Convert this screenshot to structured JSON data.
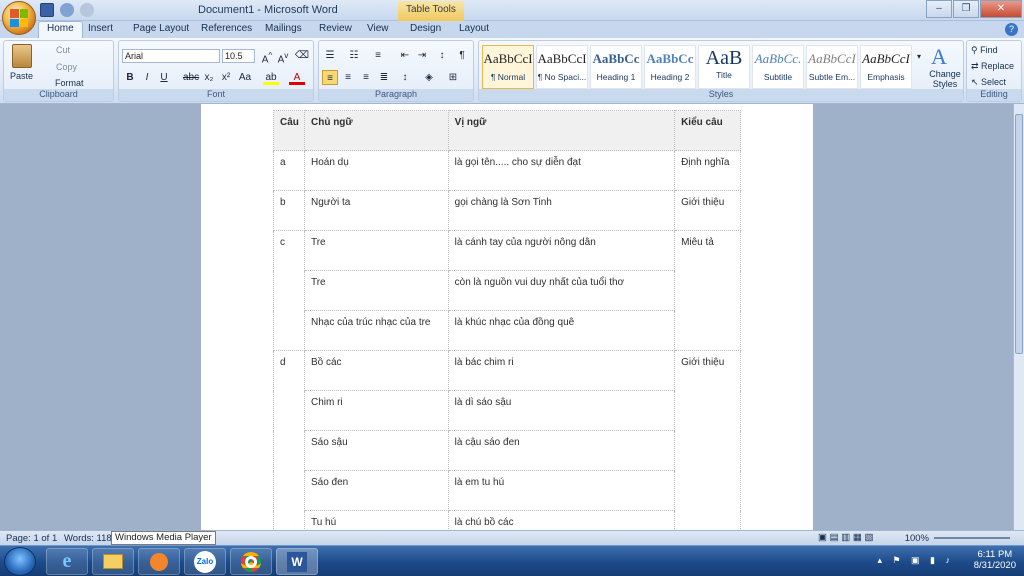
{
  "window": {
    "title": "Document1 - Microsoft Word",
    "contextual_tab": "Table Tools"
  },
  "tabs": [
    "Home",
    "Insert",
    "Page Layout",
    "References",
    "Mailings",
    "Review",
    "View",
    "Design",
    "Layout"
  ],
  "ribbon": {
    "clipboard": {
      "paste": "Paste",
      "cut": "Cut",
      "copy": "Copy",
      "format_painter": "Format Painter",
      "label": "Clipboard"
    },
    "font": {
      "name": "Arial",
      "size": "10.5",
      "label": "Font"
    },
    "paragraph": {
      "label": "Paragraph"
    },
    "styles": {
      "items": [
        {
          "sample": "AaBbCcI",
          "name": "¶ Normal"
        },
        {
          "sample": "AaBbCcI",
          "name": "¶ No Spaci..."
        },
        {
          "sample": "AaBbCc",
          "name": "Heading 1"
        },
        {
          "sample": "AaBbCc",
          "name": "Heading 2"
        },
        {
          "sample": "AaB",
          "name": "Title"
        },
        {
          "sample": "AaBbCc.",
          "name": "Subtitle"
        },
        {
          "sample": "AaBbCcI",
          "name": "Subtle Em..."
        },
        {
          "sample": "AaBbCcI",
          "name": "Emphasis"
        }
      ],
      "change_styles": "Change Styles",
      "label": "Styles"
    },
    "editing": {
      "find": "Find",
      "replace": "Replace",
      "select": "Select",
      "label": "Editing"
    }
  },
  "table": {
    "headers": [
      "Câu",
      "Chủ ngữ",
      "Vị ngữ",
      "Kiểu câu"
    ],
    "rows": [
      [
        "a",
        "Hoán dụ",
        "là gọi tên..... cho sự diễn đạt",
        "Định nghĩa"
      ],
      [
        "b",
        "Người ta",
        "gọi chàng là Sơn Tinh",
        "Giới thiệu"
      ],
      [
        "c",
        "Tre",
        "là cánh tay của người nông dân",
        "Miêu tả"
      ],
      [
        "",
        "Tre",
        "còn là nguồn vui duy nhất của tuổi thơ",
        ""
      ],
      [
        "",
        "Nhạc của trúc nhạc của tre",
        "là khúc nhạc của đồng quê",
        ""
      ],
      [
        "d",
        "Bồ các",
        "là bác chim ri",
        "Giới thiệu"
      ],
      [
        "",
        "Chim ri",
        "là dì sáo sậu",
        ""
      ],
      [
        "",
        "Sáo sậu",
        "là cậu sáo đen",
        ""
      ],
      [
        "",
        "Sáo đen",
        "là em tu hú",
        ""
      ],
      [
        "",
        "Tu hú",
        "là chú bồ các",
        ""
      ]
    ]
  },
  "status": {
    "page": "Page: 1 of 1",
    "words": "Words: 118",
    "tooltip": "Windows Media Player",
    "zoom": "100%"
  },
  "taskbar": {
    "apps": [
      "Internet Explorer",
      "File Explorer",
      "Media Player",
      "Zalo",
      "Chrome",
      "Microsoft Word"
    ],
    "zalo_label": "Zalo",
    "time": "6:11 PM",
    "date": "8/31/2020"
  },
  "colors": {
    "ribbon_bg": "#dde8f6",
    "taskbar": "#1d4b8a",
    "accent": "#e9b74b"
  }
}
